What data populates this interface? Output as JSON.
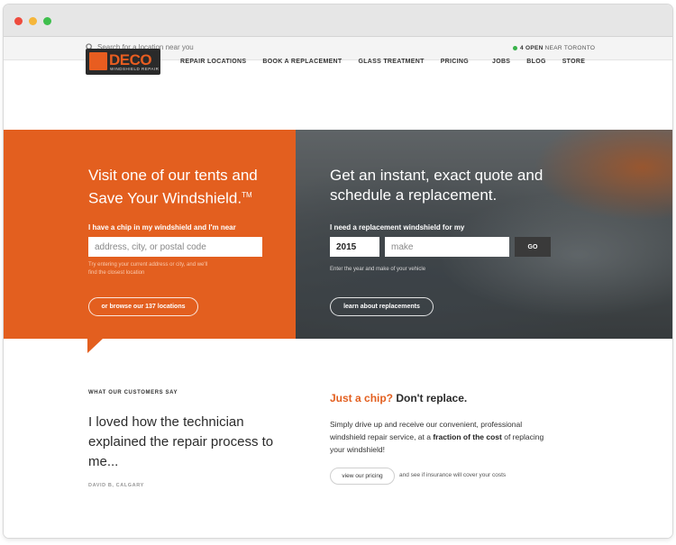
{
  "topbar": {
    "search_placeholder": "Search for a location near you",
    "status_count": "4 OPEN",
    "status_suffix": "NEAR TORONTO"
  },
  "logo": {
    "wordmark": "DECO",
    "tagline": "WINDSHIELD REPAIR"
  },
  "nav": {
    "main": [
      "REPAIR LOCATIONS",
      "BOOK A REPLACEMENT",
      "GLASS TREATMENT",
      "PRICING"
    ],
    "right": [
      "JOBS",
      "BLOG",
      "STORE"
    ]
  },
  "hero_left": {
    "title_line1": "Visit one of our tents and",
    "title_line2": "Save Your Windshield.",
    "trademark": "TM",
    "label": "I have a chip in my windshield and I'm near",
    "placeholder": "address, city, or postal code",
    "help_line1": "Try entering your current address or city, and we'll",
    "help_line2": "find the closest location",
    "browse_button": "or browse our 137 locations"
  },
  "hero_right": {
    "title_line1": "Get an instant, exact quote and",
    "title_line2": "schedule a replacement.",
    "label": "I need a replacement windshield for my",
    "year_value": "2015",
    "make_placeholder": "make",
    "go_button": "GO",
    "help": "Enter the year and make of your vehicle",
    "learn_button": "learn about replacements"
  },
  "testimonial": {
    "eyebrow": "WHAT OUR CUSTOMERS SAY",
    "quote": "I loved how the technician explained the repair process to me...",
    "author": "DAVID B, CALGARY"
  },
  "chip": {
    "title_orange": "Just a chip?",
    "title_dark": "Don't replace.",
    "body_1": "Simply drive up and receive our convenient, professional windshield repair service, at a ",
    "body_bold": "fraction of the cost",
    "body_2": " of replacing your windshield!",
    "pricing_button": "view our pricing",
    "pricing_note": "and see if insurance will cover your costs"
  },
  "colors": {
    "brand_orange": "#e35f1f",
    "status_green": "#38b24a",
    "dark_button": "#3a3a3a"
  }
}
